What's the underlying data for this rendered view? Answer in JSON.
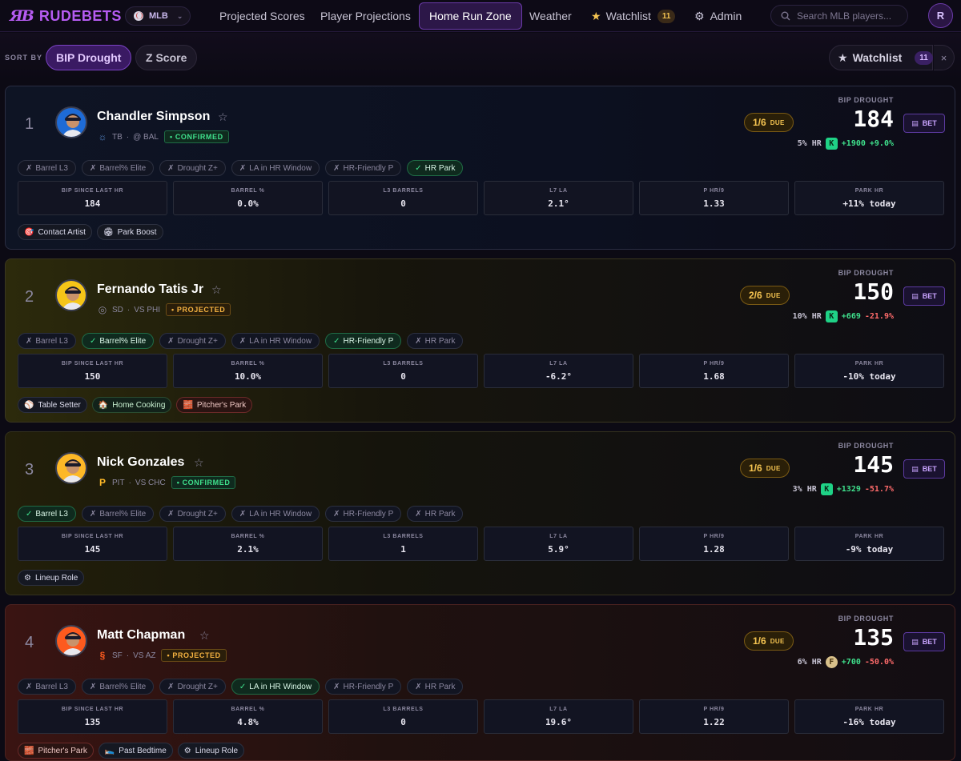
{
  "brand": {
    "mark": "ЯB",
    "name": "RUDEBETS"
  },
  "sport": {
    "label": "MLB"
  },
  "nav": {
    "items": [
      {
        "label": "Projected Scores"
      },
      {
        "label": "Player Projections"
      },
      {
        "label": "Home Run Zone",
        "active": true
      },
      {
        "label": "Weather"
      },
      {
        "label": "Watchlist",
        "badge": "11"
      },
      {
        "label": "Admin"
      }
    ]
  },
  "search": {
    "placeholder": "Search MLB players..."
  },
  "user": {
    "initial": "R"
  },
  "sortbar": {
    "label": "SORT BY",
    "options": [
      "BIP Drought",
      "Z Score"
    ],
    "selected": "BIP Drought",
    "watchlist_label": "Watchlist",
    "watchlist_count": "11"
  },
  "labels": {
    "bip_drought": "BIP DROUGHT",
    "bet": "BET",
    "due": "DUE",
    "hr_suffix": "HR",
    "stat_labels": [
      "BIP SINCE LAST HR",
      "BARREL %",
      "L3 BARRELS",
      "L7 LA",
      "P HR/9",
      "PARK HR"
    ]
  },
  "players": [
    {
      "rank": "1",
      "name": "Chandler Simpson",
      "team": "TB",
      "matchup": "@ BAL",
      "status": "CONFIRMED",
      "due": "1/6",
      "drought": "184",
      "hr_pct": "5%",
      "book": "K",
      "odds": "+1900",
      "edge": "+9.0%",
      "edge_sign": "pos",
      "chips": [
        {
          "label": "Barrel L3",
          "ok": false
        },
        {
          "label": "Barrel% Elite",
          "ok": false
        },
        {
          "label": "Drought Z+",
          "ok": false
        },
        {
          "label": "LA in HR Window",
          "ok": false
        },
        {
          "label": "HR-Friendly P",
          "ok": false
        },
        {
          "label": "HR Park",
          "ok": true
        }
      ],
      "stats": [
        "184",
        "0.0%",
        "0",
        "2.1°",
        "1.33",
        "+11% today"
      ],
      "park_sign": "pos",
      "tags": [
        {
          "icon": "🎯",
          "label": "Contact Artist",
          "kind": "ts"
        },
        {
          "icon": "🏟",
          "label": "Park Boost",
          "kind": "ts"
        }
      ],
      "avatar_color": "#1e6bd6"
    },
    {
      "rank": "2",
      "name": "Fernando Tatis Jr",
      "team": "SD",
      "matchup": "VS PHI",
      "status": "PROJECTED",
      "due": "2/6",
      "drought": "150",
      "hr_pct": "10%",
      "book": "K",
      "odds": "+669",
      "edge": "-21.9%",
      "edge_sign": "neg",
      "chips": [
        {
          "label": "Barrel L3",
          "ok": false
        },
        {
          "label": "Barrel% Elite",
          "ok": true
        },
        {
          "label": "Drought Z+",
          "ok": false
        },
        {
          "label": "LA in HR Window",
          "ok": false
        },
        {
          "label": "HR-Friendly P",
          "ok": true
        },
        {
          "label": "HR Park",
          "ok": false
        }
      ],
      "stats": [
        "150",
        "10.0%",
        "0",
        "-6.2°",
        "1.68",
        "-10% today"
      ],
      "park_sign": "neg",
      "tags": [
        {
          "icon": "⚾",
          "label": "Table Setter",
          "kind": "ts"
        },
        {
          "icon": "🏠",
          "label": "Home Cooking",
          "kind": "home"
        },
        {
          "icon": "🧱",
          "label": "Pitcher's Park",
          "kind": "warn"
        }
      ],
      "avatar_color": "#f5c518"
    },
    {
      "rank": "3",
      "name": "Nick Gonzales",
      "team": "PIT",
      "matchup": "VS CHC",
      "status": "CONFIRMED",
      "due": "1/6",
      "drought": "145",
      "hr_pct": "3%",
      "book": "K",
      "odds": "+1329",
      "edge": "-51.7%",
      "edge_sign": "neg",
      "chips": [
        {
          "label": "Barrel L3",
          "ok": true
        },
        {
          "label": "Barrel% Elite",
          "ok": false
        },
        {
          "label": "Drought Z+",
          "ok": false
        },
        {
          "label": "LA in HR Window",
          "ok": false
        },
        {
          "label": "HR-Friendly P",
          "ok": false
        },
        {
          "label": "HR Park",
          "ok": false
        }
      ],
      "stats": [
        "145",
        "2.1%",
        "1",
        "5.9°",
        "1.28",
        "-9% today"
      ],
      "park_sign": "neg",
      "tags": [
        {
          "icon": "⚙",
          "label": "Lineup Role",
          "kind": "ts"
        }
      ],
      "avatar_color": "#fdb827"
    },
    {
      "rank": "4",
      "name": "Matt Chapman",
      "team": "SF",
      "matchup": "VS AZ",
      "status": "PROJECTED",
      "due": "1/6",
      "drought": "135",
      "hr_pct": "6%",
      "book": "F",
      "odds": "+700",
      "edge": "-50.0%",
      "edge_sign": "neg",
      "chips": [
        {
          "label": "Barrel L3",
          "ok": false
        },
        {
          "label": "Barrel% Elite",
          "ok": false
        },
        {
          "label": "Drought Z+",
          "ok": false
        },
        {
          "label": "LA in HR Window",
          "ok": true
        },
        {
          "label": "HR-Friendly P",
          "ok": false
        },
        {
          "label": "HR Park",
          "ok": false
        }
      ],
      "stats": [
        "135",
        "4.8%",
        "0",
        "19.6°",
        "1.22",
        "-16% today"
      ],
      "park_sign": "neg",
      "tags": [
        {
          "icon": "🧱",
          "label": "Pitcher's Park",
          "kind": "warn"
        },
        {
          "icon": "🛌",
          "label": "Past Bedtime",
          "kind": "ts"
        },
        {
          "icon": "⚙",
          "label": "Lineup Role",
          "kind": "ts"
        }
      ],
      "avatar_color": "#fd5a1e"
    }
  ]
}
